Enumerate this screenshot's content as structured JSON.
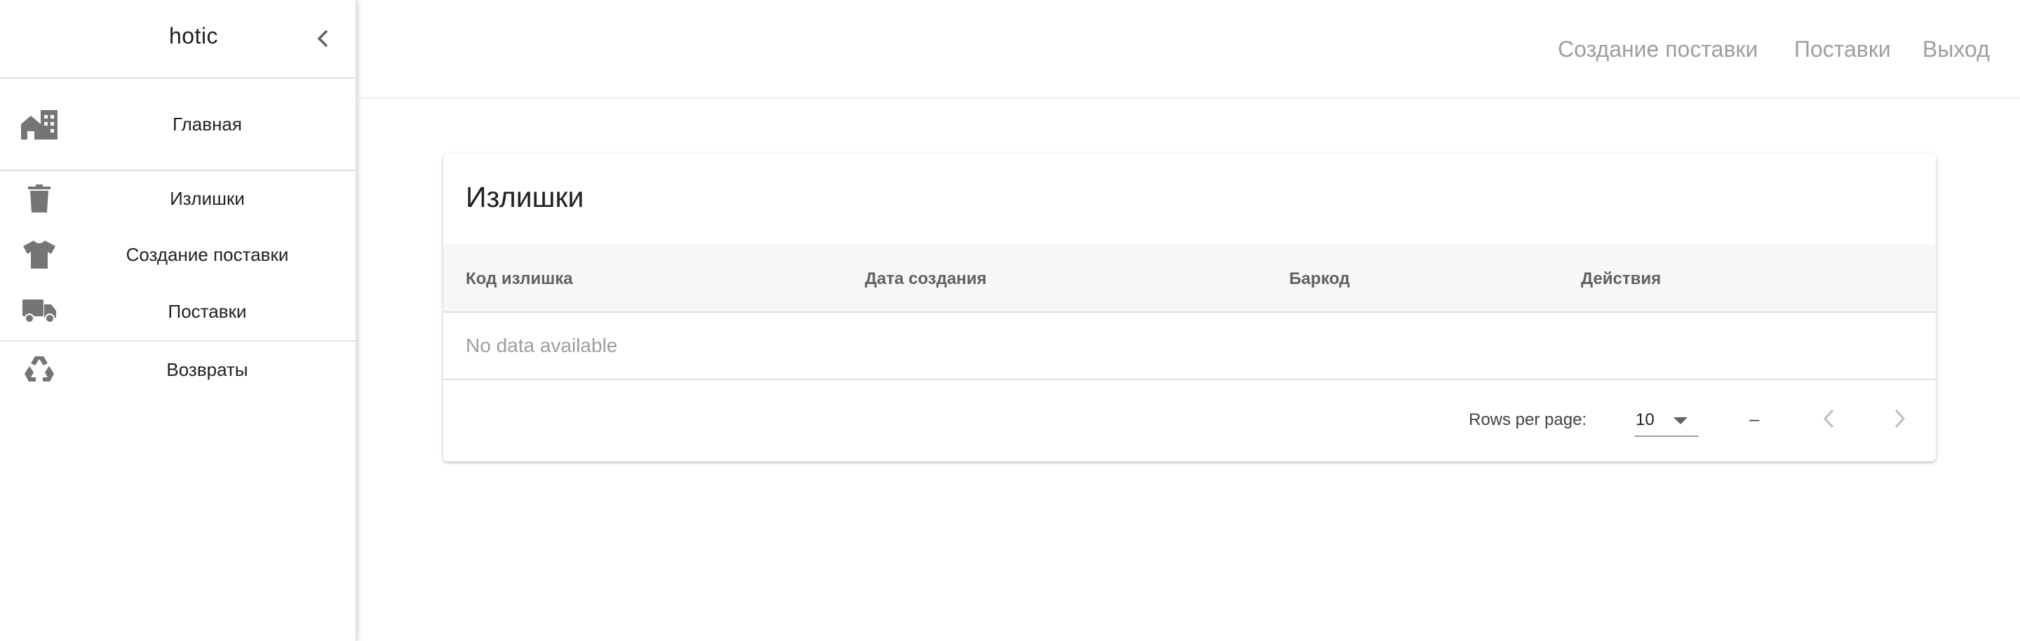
{
  "sidebar": {
    "title": "hotic",
    "items": [
      {
        "label": "Главная",
        "icon": "building-icon"
      },
      {
        "label": "Излишки",
        "icon": "trash-icon"
      },
      {
        "label": "Создание поставки",
        "icon": "shirt-icon"
      },
      {
        "label": "Поставки",
        "icon": "truck-icon"
      },
      {
        "label": "Возвраты",
        "icon": "recycle-icon"
      }
    ]
  },
  "topnav": {
    "links": [
      "Создание поставки",
      "Поставки",
      "Выход"
    ]
  },
  "card": {
    "title": "Излишки",
    "columns": [
      "Код излишка",
      "Дата создания",
      "Баркод",
      "Действия"
    ],
    "empty_text": "No data available",
    "footer": {
      "rows_per_page_label": "Rows per page:",
      "rows_per_page_value": "10",
      "range_text": "–"
    }
  },
  "colors": {
    "icon": "#757575",
    "muted_text": "#9e9e9e",
    "header_bg": "#f7f7f7"
  }
}
